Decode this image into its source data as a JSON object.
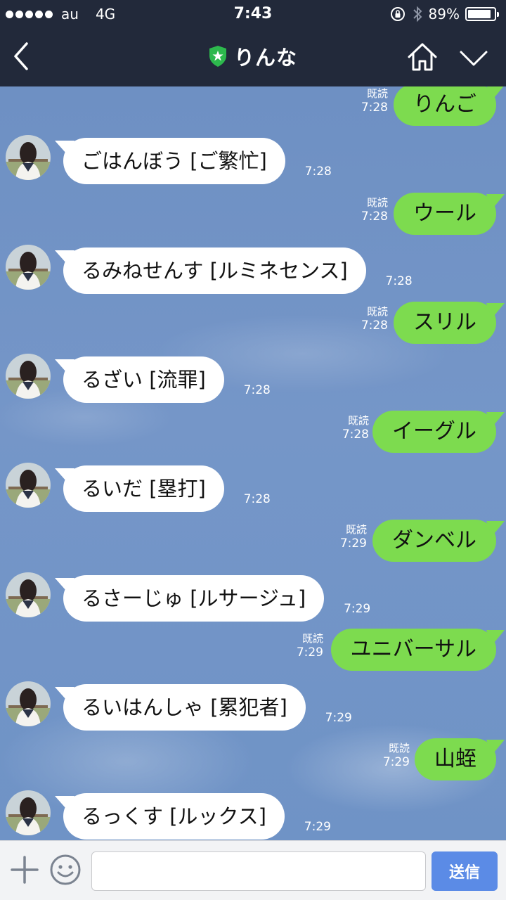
{
  "status_bar": {
    "carrier": "au",
    "network": "4G",
    "time": "7:43",
    "battery_text": "89%",
    "battery_level": 0.89
  },
  "header": {
    "title": "りんな",
    "badge_color": "#2db84d"
  },
  "messages": [
    {
      "side": "out",
      "text": "りんご",
      "read": "既読",
      "time": "7:28"
    },
    {
      "side": "in",
      "text": "ごはんぼう [ご繁忙]",
      "time": "7:28"
    },
    {
      "side": "out",
      "text": "ウール",
      "read": "既読",
      "time": "7:28"
    },
    {
      "side": "in",
      "text": "るみねせんす [ルミネセンス]",
      "time": "7:28"
    },
    {
      "side": "out",
      "text": "スリル",
      "read": "既読",
      "time": "7:28"
    },
    {
      "side": "in",
      "text": "るざい [流罪]",
      "time": "7:28"
    },
    {
      "side": "out",
      "text": "イーグル",
      "read": "既読",
      "time": "7:28"
    },
    {
      "side": "in",
      "text": "るいだ [塁打]",
      "time": "7:28"
    },
    {
      "side": "out",
      "text": "ダンベル",
      "read": "既読",
      "time": "7:29"
    },
    {
      "side": "in",
      "text": "るさーじゅ [ルサージュ]",
      "time": "7:29"
    },
    {
      "side": "out",
      "text": "ユニバーサル",
      "read": "既読",
      "time": "7:29"
    },
    {
      "side": "in",
      "text": "るいはんしゃ [累犯者]",
      "time": "7:29"
    },
    {
      "side": "out",
      "text": "山蛭",
      "read": "既読",
      "time": "7:29"
    },
    {
      "side": "in",
      "text": "るっくす [ルックス]",
      "time": "7:29"
    }
  ],
  "input_bar": {
    "placeholder": "",
    "value": "",
    "send_label": "送信"
  },
  "colors": {
    "outgoing_bubble": "#7ddb4f",
    "incoming_bubble": "#ffffff",
    "header_bg": "#22293a",
    "send_button": "#5b8be6"
  }
}
